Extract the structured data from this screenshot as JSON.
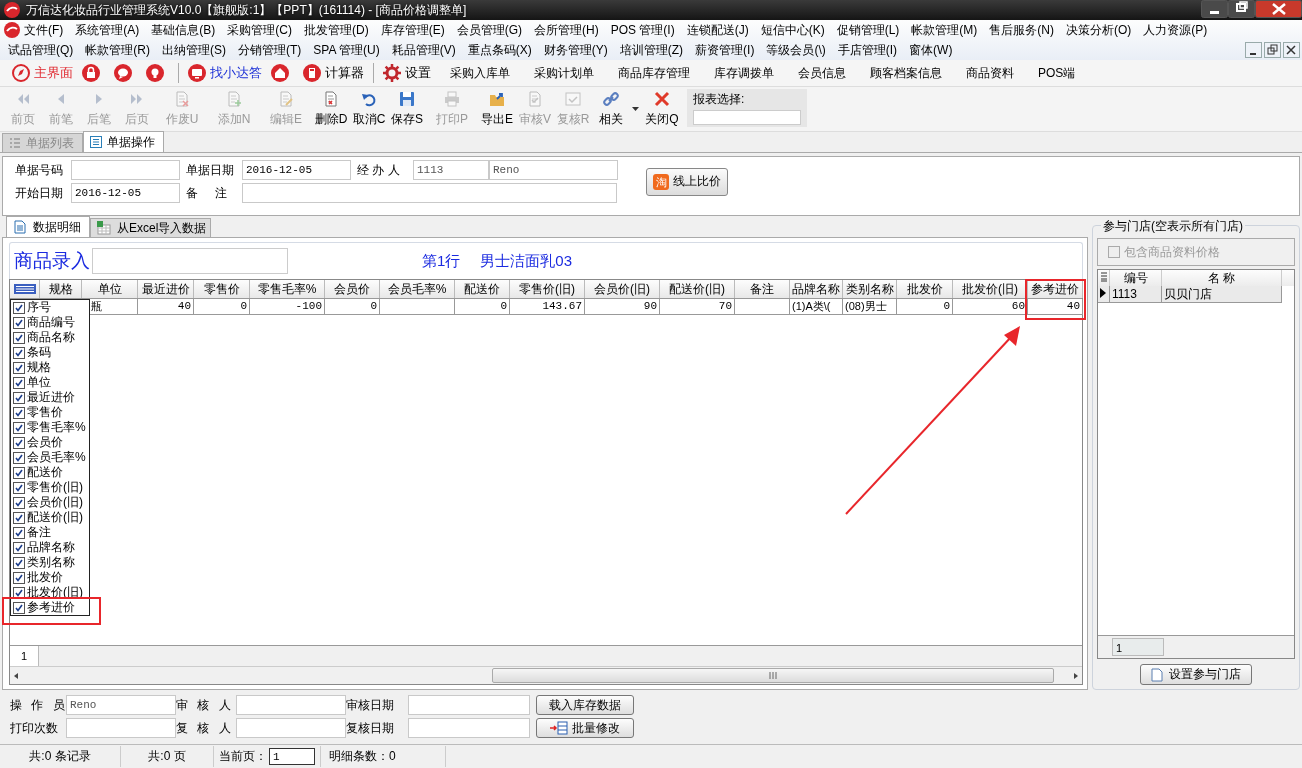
{
  "window": {
    "title": "万信达化妆品行业管理系统V10.0【旗舰版:1】【PPT】(161114) - [商品价格调整单]"
  },
  "menu_rows": [
    [
      "文件(F)",
      "系统管理(A)",
      "基础信息(B)",
      "采购管理(C)",
      "批发管理(D)",
      "库存管理(E)",
      "会员管理(G)",
      "会所管理(H)",
      "POS 管理(I)",
      "连锁配送(J)",
      "短信中心(K)",
      "促销管理(L)",
      "帐款管理(M)",
      "售后服务(N)",
      "决策分析(O)",
      "人力资源(P)"
    ],
    [
      "试品管理(Q)",
      "帐款管理(R)",
      "出纳管理(S)",
      "分销管理(T)",
      "SPA 管理(U)",
      "耗品管理(V)",
      "重点条码(X)",
      "财务管理(Y)",
      "培训管理(Z)",
      "薪资管理(I)",
      "等级会员(\\)",
      "手店管理(I)",
      "窗体(W)"
    ]
  ],
  "quick_bar": [
    {
      "kind": "main",
      "label": "主界面"
    },
    {
      "kind": "lock"
    },
    {
      "kind": "chat"
    },
    {
      "kind": "bulb"
    },
    {
      "kind": "helper",
      "label": "找小达答"
    },
    {
      "kind": "home"
    },
    {
      "kind": "calc",
      "label": "计算器"
    },
    {
      "kind": "settings",
      "label": "设置"
    },
    {
      "kind": "link",
      "label": "采购入库单"
    },
    {
      "kind": "link",
      "label": "采购计划单"
    },
    {
      "kind": "link",
      "label": "商品库存管理"
    },
    {
      "kind": "link",
      "label": "库存调拨单"
    },
    {
      "kind": "link",
      "label": "会员信息"
    },
    {
      "kind": "link",
      "label": "顾客档案信息"
    },
    {
      "kind": "link",
      "label": "商品资料"
    },
    {
      "kind": "link",
      "label": "POS端"
    }
  ],
  "toolbar": {
    "buttons": [
      {
        "kind": "first",
        "label": "前页",
        "disabled": true
      },
      {
        "kind": "prev",
        "label": "前笔",
        "disabled": true
      },
      {
        "kind": "next",
        "label": "后笔",
        "disabled": true
      },
      {
        "kind": "last",
        "label": "后页",
        "disabled": true
      },
      {
        "kind": "void",
        "label": "作废U",
        "disabled": true
      },
      {
        "kind": "add",
        "label": "添加N",
        "disabled": true
      },
      {
        "kind": "edit",
        "label": "编辑E",
        "disabled": true
      },
      {
        "kind": "delete",
        "label": "删除D",
        "disabled": false
      },
      {
        "kind": "cancel",
        "label": "取消C",
        "disabled": false
      },
      {
        "kind": "save",
        "label": "保存S",
        "disabled": false
      },
      {
        "kind": "print",
        "label": "打印P",
        "disabled": true
      },
      {
        "kind": "export",
        "label": "导出E",
        "disabled": false
      },
      {
        "kind": "audit",
        "label": "审核V",
        "disabled": true
      },
      {
        "kind": "recheck",
        "label": "复核R",
        "disabled": true
      },
      {
        "kind": "related",
        "label": "相关",
        "disabled": false
      },
      {
        "kind": "close",
        "label": "关闭Q",
        "disabled": false
      }
    ],
    "report_select": {
      "label": "报表选择:"
    }
  },
  "doc_tabs": [
    {
      "label": "单据列表",
      "selected": false
    },
    {
      "label": "单据操作",
      "selected": true
    }
  ],
  "header_form": {
    "doc_no": {
      "label": "单据号码"
    },
    "doc_date": {
      "label": "单据日期",
      "value": "2016-12-05"
    },
    "handler": {
      "label": "经 办 人",
      "value": "1113",
      "name": "Reno"
    },
    "start_date": {
      "label": "开始日期",
      "value": "2016-12-05"
    },
    "remark": {
      "label": "备 注"
    },
    "compare_button": {
      "icon_text": "淘",
      "label": "线上比价"
    }
  },
  "detail_tabs": [
    {
      "kind": "doc",
      "label": "数据明细",
      "selected": true
    },
    {
      "kind": "excel",
      "label": "从Excel导入数据",
      "selected": false
    }
  ],
  "entry": {
    "label": "商品录入",
    "row_info": "第1行",
    "product": "男士洁面乳03"
  },
  "grid": {
    "columns": [
      {
        "label": "规格",
        "kind": "text"
      },
      {
        "label": "单位",
        "kind": "text"
      },
      {
        "label": "最近进价",
        "kind": "number"
      },
      {
        "label": "零售价",
        "kind": "number"
      },
      {
        "label": "零售毛率%",
        "kind": "number"
      },
      {
        "label": "会员价",
        "kind": "number"
      },
      {
        "label": "会员毛率%",
        "kind": "number"
      },
      {
        "label": "配送价",
        "kind": "number"
      },
      {
        "label": "零售价(旧)",
        "kind": "number"
      },
      {
        "label": "会员价(旧)",
        "kind": "number"
      },
      {
        "label": "配送价(旧)",
        "kind": "number"
      },
      {
        "label": "备注",
        "kind": "text"
      },
      {
        "label": "品牌名称",
        "kind": "text"
      },
      {
        "label": "类别名称",
        "kind": "text"
      },
      {
        "label": "批发价",
        "kind": "number"
      },
      {
        "label": "批发价(旧)",
        "kind": "number"
      },
      {
        "label": "参考进价",
        "kind": "number"
      }
    ],
    "rows": [
      [
        null,
        "瓶",
        "40",
        "0",
        "-100",
        "0",
        null,
        "0",
        "143.67",
        "90",
        "70",
        null,
        "(1)A类\\(",
        "(08)男士",
        "0",
        "60",
        "40"
      ]
    ],
    "footer": "1"
  },
  "column_chooser": [
    {
      "label": "序号",
      "checked": true
    },
    {
      "label": "商品编号",
      "checked": true
    },
    {
      "label": "商品名称",
      "checked": true
    },
    {
      "label": "条码",
      "checked": true
    },
    {
      "label": "规格",
      "checked": true
    },
    {
      "label": "单位",
      "checked": true
    },
    {
      "label": "最近进价",
      "checked": true
    },
    {
      "label": "零售价",
      "checked": true
    },
    {
      "label": "零售毛率%",
      "checked": true
    },
    {
      "label": "会员价",
      "checked": true
    },
    {
      "label": "会员毛率%",
      "checked": true
    },
    {
      "label": "配送价",
      "checked": true
    },
    {
      "label": "零售价(旧)",
      "checked": true
    },
    {
      "label": "会员价(旧)",
      "checked": true
    },
    {
      "label": "配送价(旧)",
      "checked": true
    },
    {
      "label": "备注",
      "checked": true
    },
    {
      "label": "品牌名称",
      "checked": true
    },
    {
      "label": "类别名称",
      "checked": true
    },
    {
      "label": "批发价",
      "checked": true
    },
    {
      "label": "批发价(旧)",
      "checked": true
    },
    {
      "label": "参考进价",
      "checked": true
    }
  ],
  "store_panel": {
    "title": "参与门店(空表示所有门店)",
    "include_checkbox": {
      "label": "包含商品资料价格",
      "checked": false,
      "disabled": true
    },
    "columns": [
      "编号",
      "名 称"
    ],
    "rows": [
      {
        "code": "1113",
        "name": "贝贝门店",
        "selected": true
      }
    ],
    "footer": "1",
    "button": "设置参与门店"
  },
  "footer_form": {
    "fields": [
      {
        "label": "操 作 员",
        "value": "Reno"
      },
      {
        "label": "审 核 人"
      },
      {
        "label": "审核日期"
      },
      {
        "label": "打印次数"
      },
      {
        "label": "复 核 人"
      },
      {
        "label": "复核日期"
      }
    ],
    "buttons": [
      {
        "kind": "plain",
        "label": "载入库存数据"
      },
      {
        "kind": "batch",
        "label": "批量修改"
      }
    ]
  },
  "status_bar": {
    "records": "共:0 条记录",
    "pages": "共:0 页",
    "current_page_label": "当前页：",
    "current_page": "1",
    "detail_count": "明细条数：0"
  }
}
